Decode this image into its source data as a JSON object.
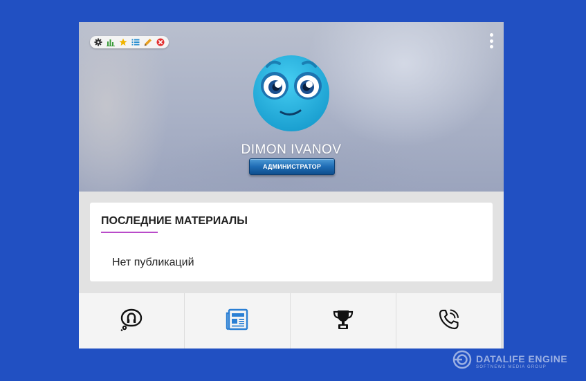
{
  "profile": {
    "username": "DIMON IVANOV",
    "role": "АДМИНИСТРАТОР"
  },
  "toolbar": {
    "icons": [
      "gear-icon",
      "bar-chart-icon",
      "star-icon",
      "list-icon",
      "pencil-icon",
      "close-icon"
    ]
  },
  "latest": {
    "title": "ПОСЛЕДНИЕ МАТЕРИАЛЫ",
    "empty_text": "Нет публикаций"
  },
  "nav": {
    "icons": [
      "thought-bubble-icon",
      "newspaper-icon",
      "trophy-icon",
      "phone-icon"
    ]
  },
  "watermark": {
    "title": "DATALIFE ENGINE",
    "subtitle": "SOFTNEWS MEDIA GROUP"
  },
  "colors": {
    "background": "#2150c2",
    "accent_underline": "#b94bc9",
    "badge": "#1f6cb4",
    "avatar": "#25b4e0"
  }
}
